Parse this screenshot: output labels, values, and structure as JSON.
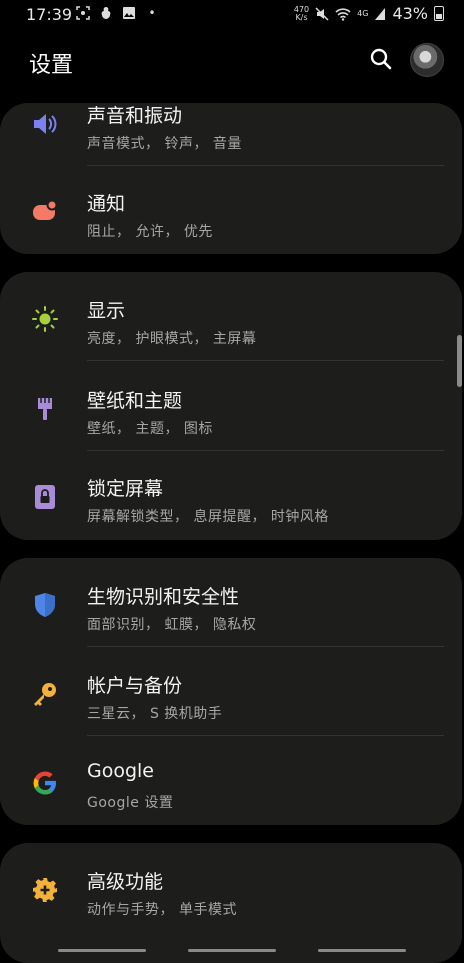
{
  "status_bar": {
    "time": "17:39",
    "net_speed_top": "470",
    "net_speed_bottom": "K/s",
    "network": "4G",
    "battery": "43%"
  },
  "header": {
    "title": "设置"
  },
  "items": {
    "sound": {
      "label": "声音和振动",
      "sub": "声音模式，  铃声，  音量",
      "icon": "speaker-icon",
      "color": "#7b82f0"
    },
    "notifications": {
      "label": "通知",
      "sub": "阻止，  允许，  优先",
      "icon": "notification-icon",
      "color": "#f47a66"
    },
    "display": {
      "label": "显示",
      "sub": "亮度，  护眼模式，  主屏幕",
      "icon": "sun-icon",
      "color": "#a6d13a"
    },
    "wallpaper": {
      "label": "壁纸和主题",
      "sub": "壁纸，  主题，  图标",
      "icon": "brush-icon",
      "color": "#a88cd8"
    },
    "lockscreen": {
      "label": "锁定屏幕",
      "sub": "屏幕解锁类型，  息屏提醒，  时钟风格",
      "icon": "lock-icon",
      "color": "#a88cd8"
    },
    "biometrics": {
      "label": "生物识别和安全性",
      "sub": "面部识别，  虹膜，  隐私权",
      "icon": "shield-icon",
      "color": "#4d86e6"
    },
    "accounts": {
      "label": "帐户与备份",
      "sub": "三星云，  S 换机助手",
      "icon": "key-icon",
      "color": "#f2b13a"
    },
    "google": {
      "label": "Google",
      "sub": "Google 设置",
      "icon": "google-icon",
      "color": "#4285f4"
    },
    "advanced": {
      "label": "高级功能",
      "sub": "动作与手势，  单手模式",
      "icon": "gear-plus-icon",
      "color": "#f2b13a"
    }
  }
}
